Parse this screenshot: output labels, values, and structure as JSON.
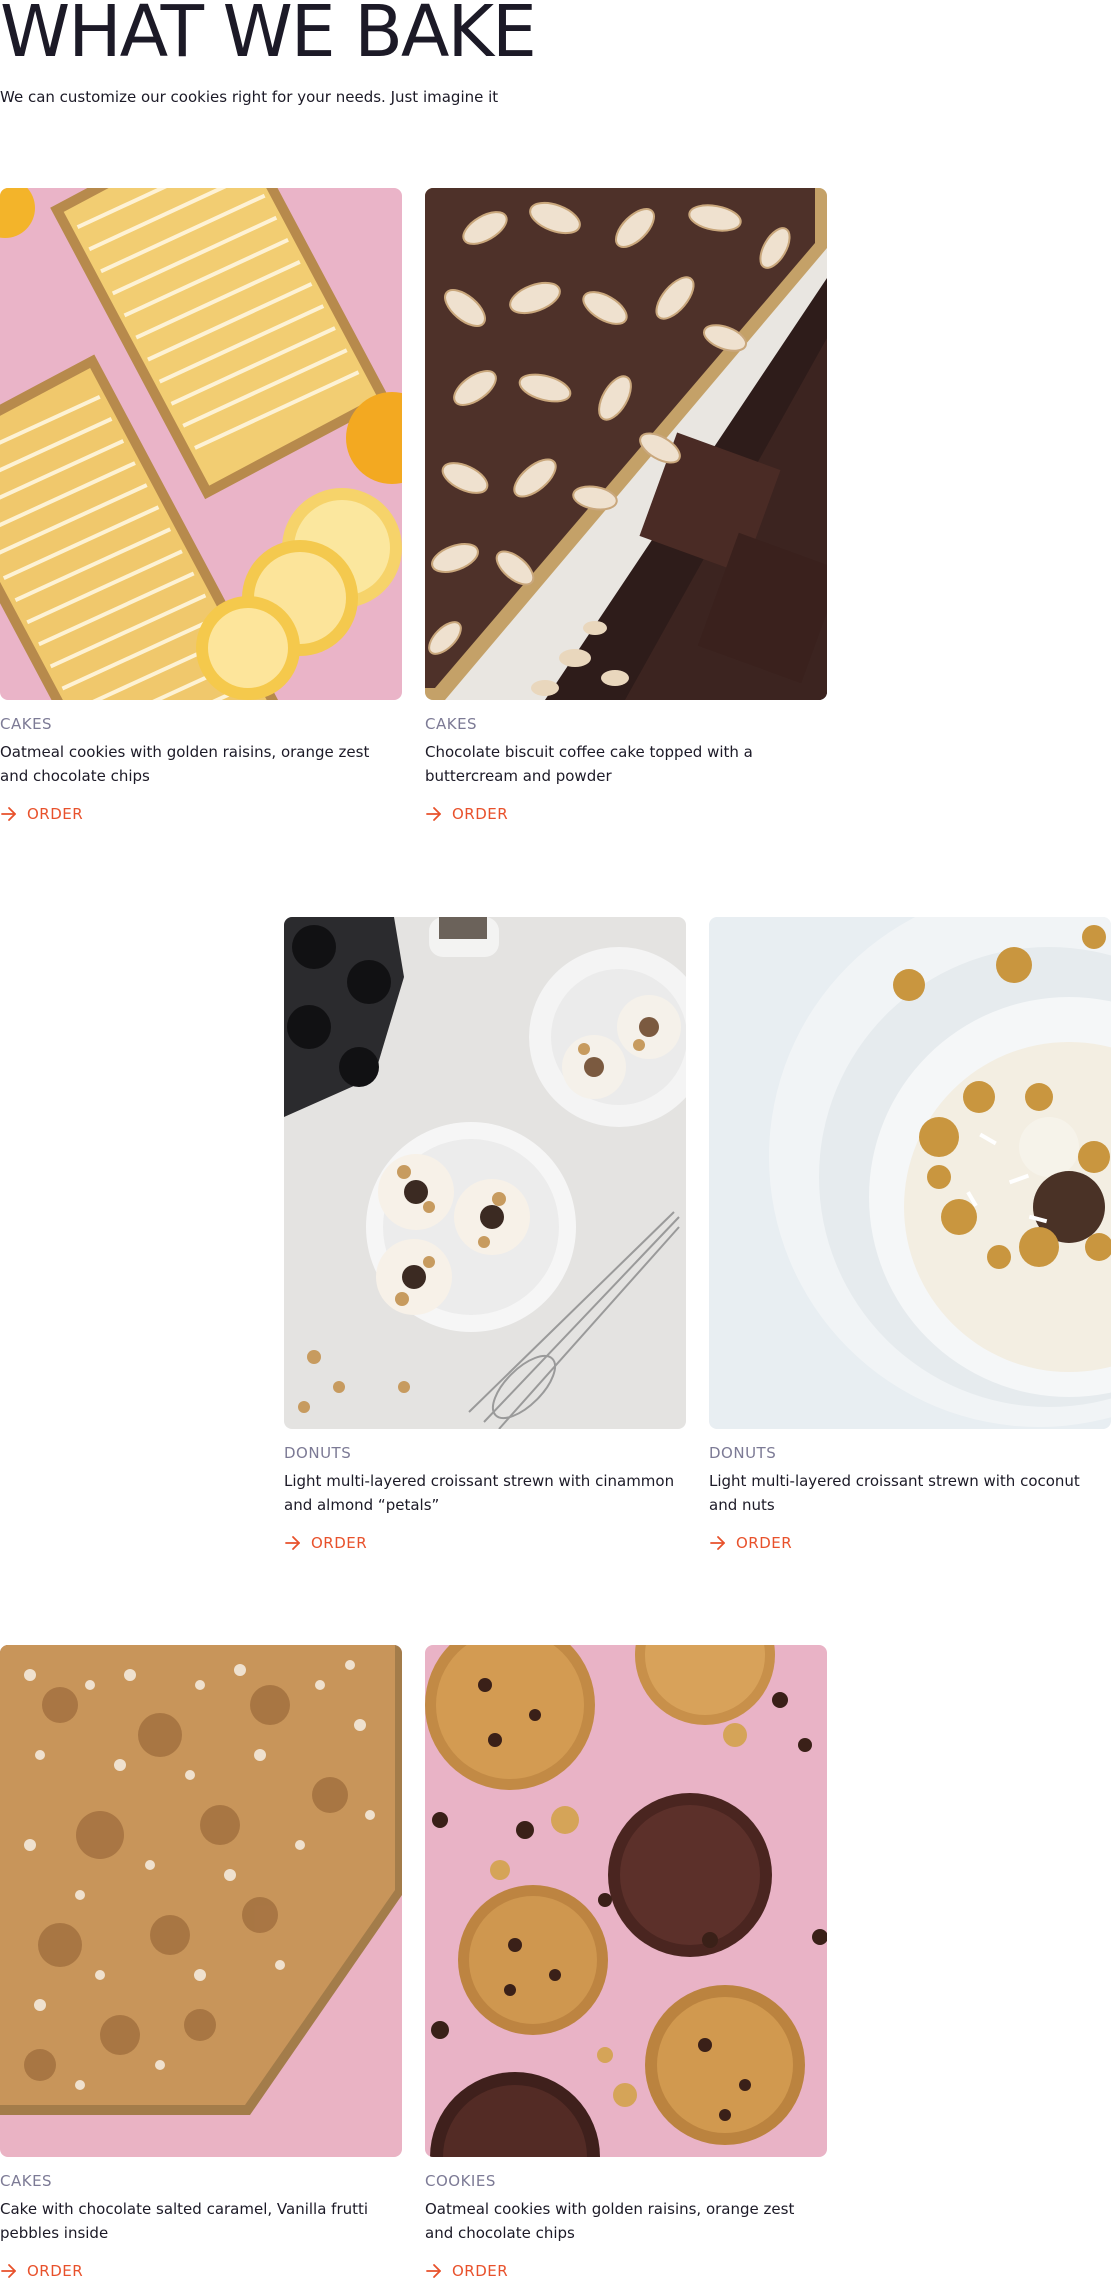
{
  "header": {
    "title": "WHAT WE BAKE",
    "subtitle": "We can customize our cookies right for your needs. Just imagine it"
  },
  "products": [
    {
      "category": "CAKES",
      "description": "Oatmeal cookies with golden raisins, orange zest and chocolate chips",
      "order_label": "ORDER",
      "image": "lemon-loaf-cake-photo"
    },
    {
      "category": "CAKES",
      "description": "Chocolate biscuit coffee cake topped with a buttercream and powder",
      "order_label": "ORDER",
      "image": "almond-chocolate-cake-photo"
    },
    {
      "category": "DONUTS",
      "description": "Light multi-layered croissant strewn with cinammon and almond “petals”",
      "order_label": "ORDER",
      "image": "glazed-donuts-photo"
    },
    {
      "category": "DONUTS",
      "description": "Light multi-layered croissant strewn with coconut and nuts",
      "order_label": "ORDER",
      "image": "walnut-donut-closeup-photo"
    },
    {
      "category": "CAKES",
      "description": "Cake with chocolate salted caramel, Vanilla frutti pebbles inside",
      "order_label": "ORDER",
      "image": "coconut-crumb-cake-photo"
    },
    {
      "category": "COOKIES",
      "description": "Oatmeal cookies with golden raisins, orange zest and chocolate chips",
      "order_label": "ORDER",
      "image": "chocolate-chip-cookies-photo"
    }
  ],
  "colors": {
    "accent": "#e8512b",
    "category": "#7c7a95",
    "text": "#1c1a27"
  },
  "icons": {
    "order": "arrow-right-icon"
  }
}
